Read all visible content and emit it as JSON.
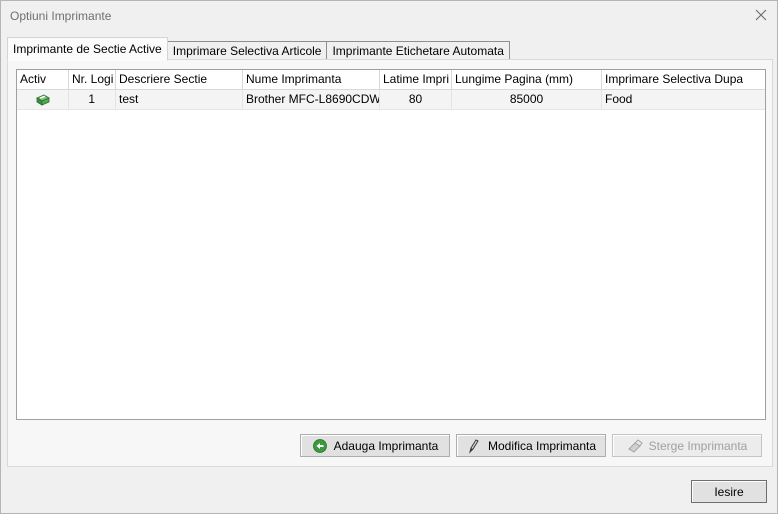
{
  "window": {
    "title": "Optiuni Imprimante"
  },
  "tabs": [
    {
      "label": "Imprimante de Sectie Active"
    },
    {
      "label": "Imprimare Selectiva Articole"
    },
    {
      "label": "Imprimante Etichetare Automata"
    }
  ],
  "grid": {
    "columns": [
      "Activ",
      "Nr. Logi",
      "Descriere Sectie",
      "Nume Imprimanta",
      "Latime Impri",
      "Lungime Pagina (mm)",
      "Imprimare Selectiva Dupa"
    ],
    "rows": [
      {
        "active_icon": "printer-icon",
        "nr": "1",
        "descriere": "test",
        "nume": "Brother MFC-L8690CDW",
        "latime": "80",
        "lungime": "85000",
        "selectiva": "Food"
      }
    ]
  },
  "buttons": {
    "add": {
      "label": "Adauga Imprimanta",
      "icon": "add-icon"
    },
    "edit": {
      "label": "Modifica Imprimanta",
      "icon": "pen-icon"
    },
    "delete": {
      "label": "Sterge Imprimanta",
      "icon": "eraser-icon"
    },
    "exit": {
      "label": "Iesire"
    }
  },
  "colors": {
    "add_icon": "#3b9a3b",
    "printer_icon": "#3c8f3c"
  }
}
